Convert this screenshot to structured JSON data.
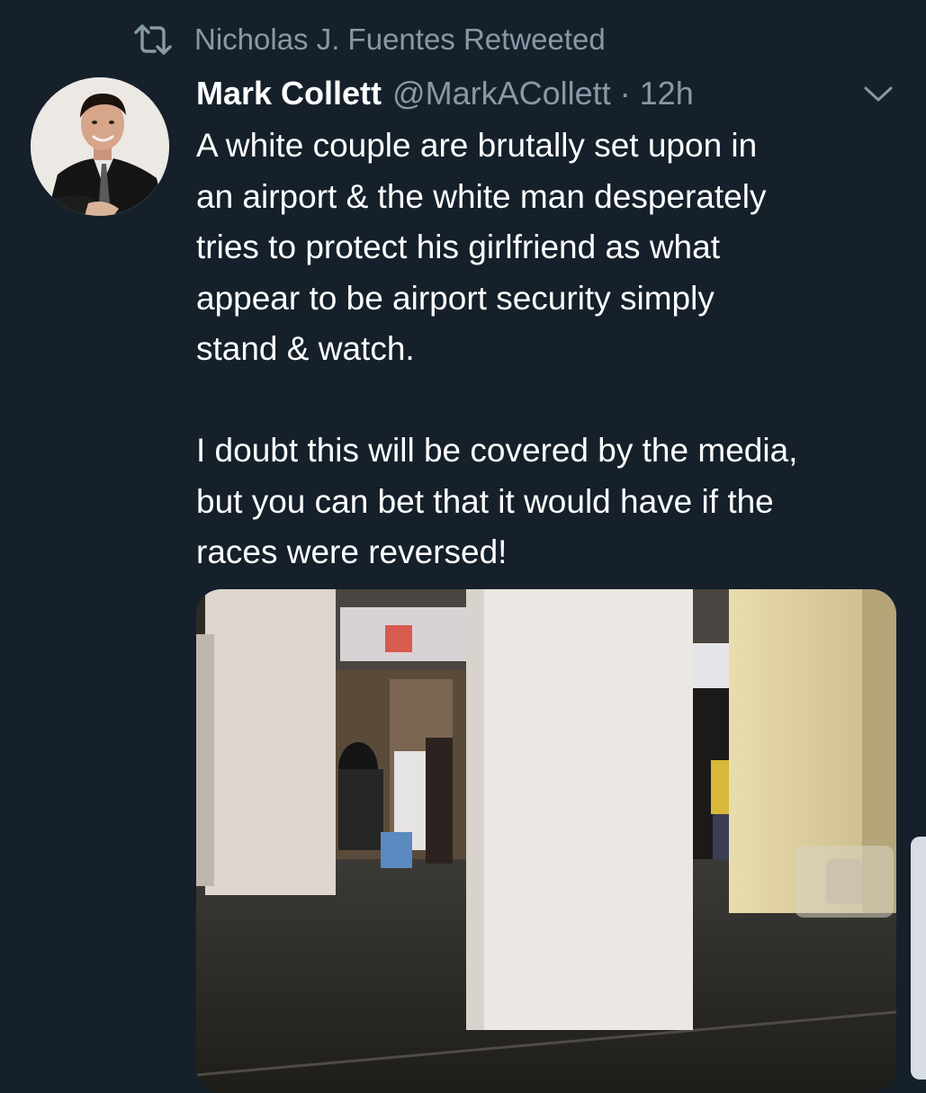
{
  "social_context": {
    "text": "Nicholas J. Fuentes Retweeted",
    "icon": "retweet-icon"
  },
  "tweet": {
    "display_name": "Mark Collett",
    "handle": "@MarkACollett",
    "separator": "·",
    "time": "12h",
    "menu_icon": "chevron-down-icon",
    "text": "A white couple are brutally set upon in\nan airport & the white man desperately\ntries to protect his girlfriend as what\nappear to be airport security simply\nstand & watch.\n\nI doubt this will be covered by the media,\nbut you can bet that it would have if the\nraces were reversed!"
  },
  "colors": {
    "background": "#15202b",
    "secondary_text": "#8899a6",
    "primary_text": "#ffffff"
  }
}
